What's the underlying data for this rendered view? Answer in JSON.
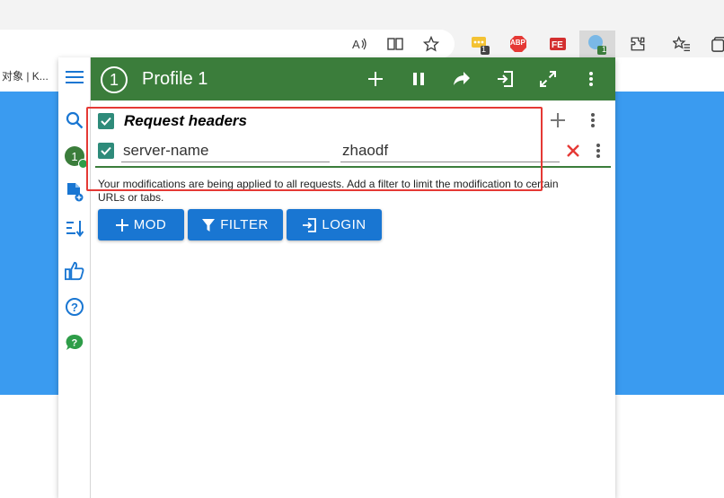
{
  "browser": {
    "tab_title": "对象 | K...",
    "extension_badge_1": "1",
    "extension_badge_2": "1",
    "abp_label": "ABP"
  },
  "popup": {
    "profile_number": "1",
    "profile_title": "Profile 1",
    "sidebar_badge": "1",
    "mod": {
      "title": "Request headers",
      "header_name": "server-name",
      "header_value": "zhaodf"
    },
    "info_text": "Your modifications are being applied to all requests. Add a filter to limit the modification to certain URLs or tabs.",
    "buttons": {
      "mod": "MOD",
      "filter": "FILTER",
      "login": "LOGIN"
    }
  },
  "colors": {
    "header_green": "#3b7d3b",
    "page_blue": "#3a9bf0",
    "button_blue": "#1976d2",
    "highlight_red": "#e53935",
    "checkbox_teal": "#2e8b7a"
  }
}
